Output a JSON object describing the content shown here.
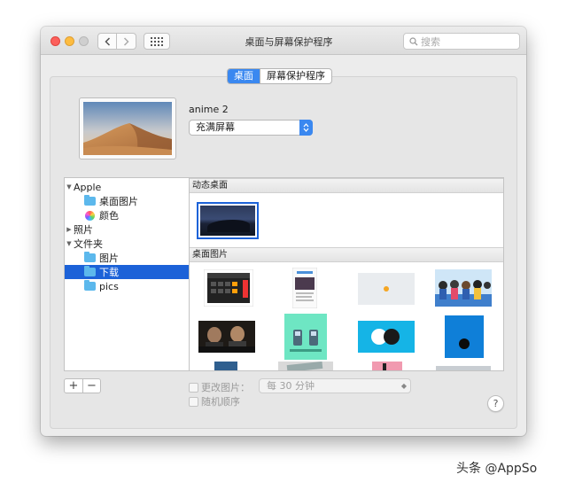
{
  "window": {
    "title": "桌面与屏幕保护程序",
    "search_placeholder": "搜索"
  },
  "tabs": [
    {
      "label": "桌面",
      "active": true
    },
    {
      "label": "屏幕保护程序",
      "active": false
    }
  ],
  "current_picture": {
    "name": "anime 2",
    "fill_mode": "充满屏幕"
  },
  "sidebar": {
    "items": [
      {
        "label": "Apple",
        "type": "group",
        "expanded": true
      },
      {
        "label": "桌面图片",
        "type": "folder"
      },
      {
        "label": "颜色",
        "type": "color"
      },
      {
        "label": "照片",
        "type": "group",
        "expanded": false
      },
      {
        "label": "文件夹",
        "type": "group",
        "expanded": true
      },
      {
        "label": "图片",
        "type": "folder"
      },
      {
        "label": "下载",
        "type": "folder",
        "selected": true
      },
      {
        "label": "pics",
        "type": "folder"
      }
    ],
    "add_label": "+",
    "remove_label": "−"
  },
  "sections": {
    "dynamic": "动态桌面",
    "desktop_pictures": "桌面图片"
  },
  "options": {
    "change_picture": "更改图片：",
    "interval": "每 30 分钟",
    "random_order": "随机顺序"
  },
  "help_label": "?",
  "watermark": "头条 @AppSo",
  "colors": {
    "accent": "#3a88f0",
    "selection": "#1c62d8",
    "folder": "#5cb8ec"
  }
}
